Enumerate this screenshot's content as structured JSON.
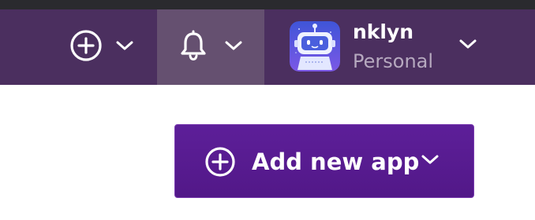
{
  "header": {
    "create_menu": {
      "icon": "plus-circle-icon",
      "chevron": "chevron-down-icon"
    },
    "notifications_menu": {
      "icon": "bell-icon",
      "chevron": "chevron-down-icon"
    },
    "account": {
      "name": "nklyn",
      "type": "Personal",
      "avatar": "robot-avatar",
      "chevron": "chevron-down-icon"
    }
  },
  "main": {
    "add_app_button": {
      "label": "Add new app",
      "icon": "plus-circle-icon",
      "chevron": "chevron-down-icon"
    }
  },
  "colors": {
    "navbar": "#4b2f5f",
    "navbar_active": "#655070",
    "primary_button": "#5a1c93",
    "text_on_dark": "#ffffff",
    "secondary_text": "#b6a9bf"
  }
}
